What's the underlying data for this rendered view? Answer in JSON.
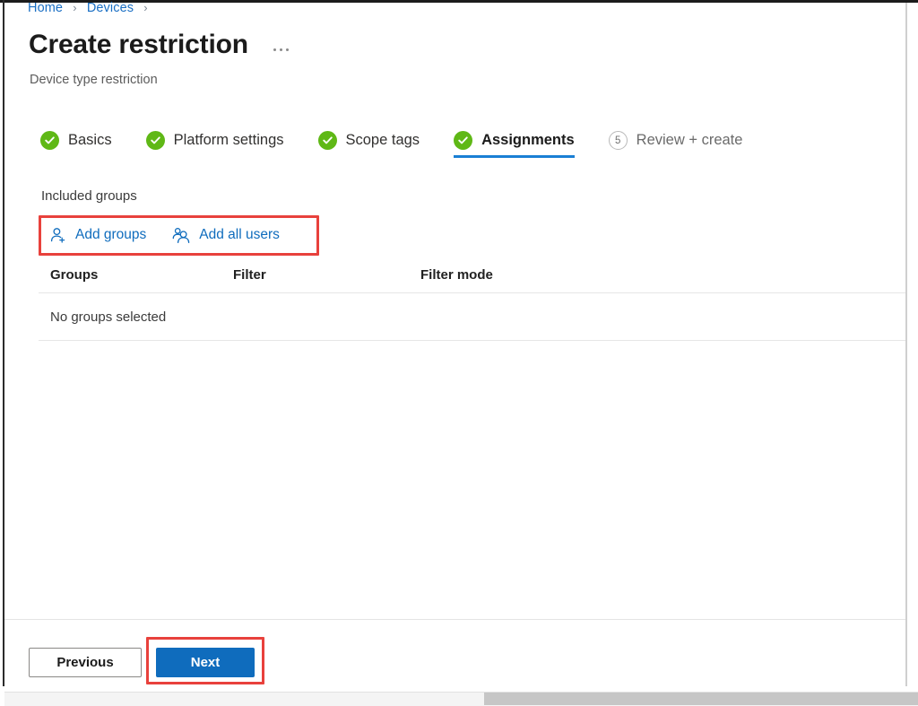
{
  "breadcrumb": {
    "items": [
      {
        "label": "Home"
      },
      {
        "label": "Devices"
      }
    ],
    "separator": "›"
  },
  "header": {
    "title": "Create restriction",
    "subtitle": "Device type restriction",
    "more_menu": "···"
  },
  "wizard": {
    "steps": [
      {
        "label": "Basics",
        "state": "done",
        "marker": "check"
      },
      {
        "label": "Platform settings",
        "state": "done",
        "marker": "check"
      },
      {
        "label": "Scope tags",
        "state": "done",
        "marker": "check"
      },
      {
        "label": "Assignments",
        "state": "active",
        "marker": "check"
      },
      {
        "label": "Review + create",
        "state": "pending",
        "marker": "5"
      }
    ]
  },
  "assignments": {
    "section_label": "Included groups",
    "commands": [
      {
        "label": "Add groups",
        "icon": "add-user-icon"
      },
      {
        "label": "Add all users",
        "icon": "users-group-icon"
      }
    ],
    "table": {
      "columns": [
        "Groups",
        "Filter",
        "Filter mode"
      ],
      "empty_message": "No groups selected"
    }
  },
  "footer": {
    "previous_label": "Previous",
    "next_label": "Next"
  },
  "colors": {
    "link_blue": "#0f6cbd",
    "primary_blue": "#0f6cbd",
    "step_green": "#5fb816",
    "active_underline": "#1a7fd4",
    "annotation_red": "#e8413c"
  }
}
